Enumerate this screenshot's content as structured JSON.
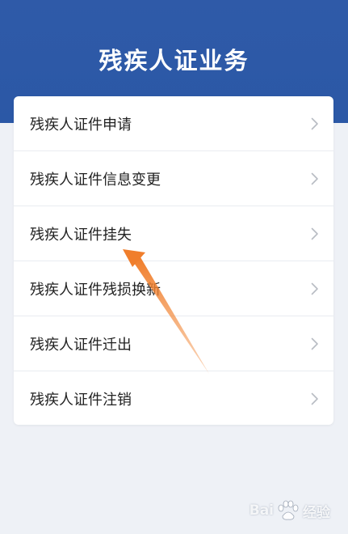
{
  "header": {
    "title": "残疾人证业务"
  },
  "menu": {
    "items": [
      {
        "label": "残疾人证件申请"
      },
      {
        "label": "残疾人证件信息变更"
      },
      {
        "label": "残疾人证件挂失"
      },
      {
        "label": "残疾人证件残损换新"
      },
      {
        "label": "残疾人证件迁出"
      },
      {
        "label": "残疾人证件注销"
      }
    ]
  },
  "watermark": {
    "left": "Bai",
    "right": "经验"
  },
  "icons": {
    "chevron": "chevron-right-icon",
    "annotation": "arrow-annotation-icon",
    "watermark": "paw-logo-icon"
  },
  "colors": {
    "header_bg": "#2b58a6",
    "page_bg": "#eef1f6",
    "arrow": "#f0863a"
  }
}
